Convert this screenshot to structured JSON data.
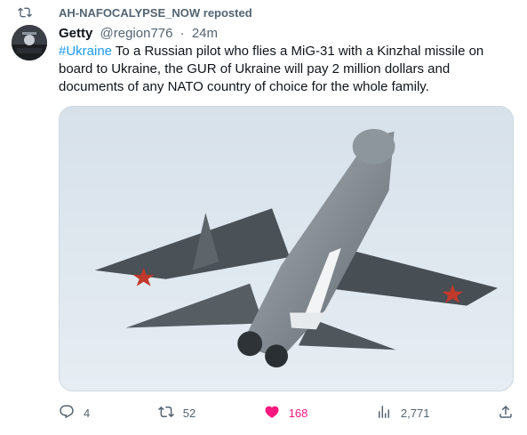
{
  "repost": {
    "icon": "repost-icon",
    "text": "AH-NAFOCALYPSE_NOW reposted"
  },
  "tweet": {
    "author_name": "Getty",
    "handle": "@region776",
    "separator": "·",
    "time": "24m",
    "hashtag": "#Ukraine",
    "text": " To a Russian pilot who flies a MiG-31 with a Kinzhal missile on board to Ukraine, the GUR of Ukraine will pay 2 million dollars and documents of any NATO country of choice for the whole family."
  },
  "actions": {
    "reply": {
      "icon": "reply-icon",
      "count": "4"
    },
    "repost": {
      "icon": "repost-icon",
      "count": "52"
    },
    "like": {
      "icon": "heart-icon",
      "count": "168",
      "color": "#f91880"
    },
    "views": {
      "icon": "views-icon",
      "count": "2,771"
    },
    "share": {
      "icon": "share-icon"
    }
  },
  "colors": {
    "accent": "#1d9bf0",
    "secondary_text": "#536471",
    "like": "#f91880"
  }
}
